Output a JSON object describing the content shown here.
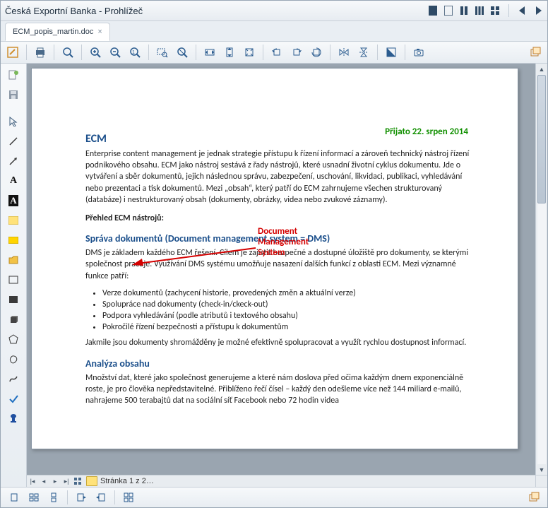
{
  "title": "Česká Exportní Banka - Prohlížeč",
  "tab": {
    "label": "ECM_popis_martin.doc"
  },
  "stamp": "Přijato 22. srpen 2014",
  "doc": {
    "h1": "ECM",
    "p1": "Enterprise content management je jednak strategie přístupu k řízení informací a zároveň technický nástroj řízení podnikového obsahu. ECM jako nástroj sestává z řady nástrojů, které usnadní životní cyklus dokumentu. Jde o vytváření a sběr dokumentů, jejich následnou správu, zabezpečení, uschování, likvidaci, publikaci, vyhledávání nebo prezentaci a tisk dokumentů. Mezi „obsah“, který patří do ECM zahrnujeme všechen strukturovaný (databáze) i nestrukturovaný obsah (dokumenty, obrázky, videa nebo zvukové záznamy).",
    "bold1": "Přehled ECM nástrojů:",
    "h2a": "Správa dokumentů (Document management system = DMS)",
    "p2": "DMS je základem každého ECM řešení. Cílem je zajistit bezpečné a dostupné úložiště pro dokumenty, se kterými společnost pracuje. Využívání DMS systému umožňuje nasazení dalších funkcí z oblasti ECM. Mezi významné funkce patří:",
    "li1": "Verze dokumentů (zachycení historie, provedených změn a aktuální verze)",
    "li2": "Spolupráce nad dokumenty (check-in/ckeck-out)",
    "li3": "Podpora vyhledávání (podle atributů i textového obsahu)",
    "li4": "Pokročilé řízení bezpečnosti a přístupu k dokumentům",
    "p3": "Jakmile jsou dokumenty shromážděny je možné efektivně spolupracovat a využít rychlou dostupnost informací.",
    "h2b": "Analýza obsahu",
    "p4": "Množství dat, které jako společnost generujeme a které nám doslova před očima každým dnem exponenciálně roste, je pro člověka nepředstavitelné. Přiblíženo řečí čísel – každý den odešleme více než 144 miliard e-mailů, nahrajeme 500 terabajtů dat na sociální síť Facebook nebo 72 hodin videa"
  },
  "annotation": {
    "l1": "Document",
    "l2": "Management",
    "l3": "System"
  },
  "statusbar": {
    "page": "Stránka 1 z 2…"
  }
}
